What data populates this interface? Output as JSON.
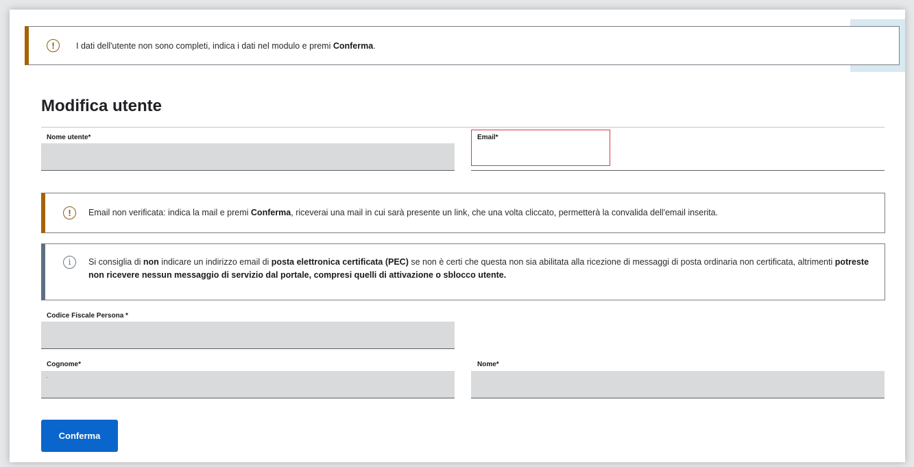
{
  "top_alert": {
    "text_before": "I dati dell'utente non sono completi, indica i dati nel modulo e premi ",
    "text_bold": "Conferma",
    "text_after": "."
  },
  "form": {
    "title": "Modifica utente",
    "fields": {
      "nome_utente": {
        "label": "Nome utente*",
        "value": ""
      },
      "email": {
        "label": "Email*",
        "value": ""
      },
      "codice_fiscale": {
        "label": "Codice Fiscale Persona *",
        "value": ""
      },
      "cognome": {
        "label": "Cognome*",
        "value": "."
      },
      "nome": {
        "label": "Nome*",
        "value": ""
      }
    },
    "email_warning": {
      "text_before": "Email non verificata: indica la mail e premi ",
      "text_bold": "Conferma",
      "text_after": ", riceverai una mail in cui sarà presente un link, che una volta cliccato, permetterà la convalida dell'email inserita."
    },
    "pec_info": {
      "t1": "Si consiglia di ",
      "b1": "non",
      "t2": " indicare un indirizzo email di ",
      "b2": "posta elettronica certificata (PEC)",
      "t3": " se non è certi che questa non sia abilitata alla ricezione di messaggi di posta ordinaria non certificata, altrimenti ",
      "b3": "potreste non ricevere nessun messaggio di servizio dal portale, compresi quelli di attivazione o sblocco utente."
    },
    "submit_label": "Conferma"
  },
  "colors": {
    "warning_accent": "#a66300",
    "info_accent": "#5d7083",
    "error_border": "#d9364f",
    "primary_button": "#0a66cc",
    "field_fill": "#d9dadb"
  },
  "icons": {
    "warning": "exclamation-circle-icon",
    "info": "info-circle-icon"
  }
}
